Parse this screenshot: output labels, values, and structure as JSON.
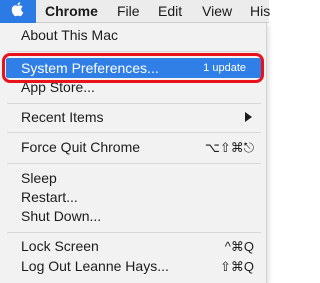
{
  "menubar": {
    "app_name": "Chrome",
    "items": [
      "File",
      "Edit",
      "View",
      "His"
    ],
    "apple_icon": "apple-logo-icon",
    "apple_tab_color": "#2c7be5"
  },
  "apple_menu": {
    "about": "About This Mac",
    "system_preferences": "System Preferences...",
    "system_preferences_badge": "1 update",
    "app_store": "App Store...",
    "recent_items": "Recent Items",
    "force_quit": "Force Quit Chrome",
    "force_quit_shortcut": "⌥⇧⌘⎋",
    "sleep": "Sleep",
    "restart": "Restart...",
    "shut_down": "Shut Down...",
    "lock_screen": "Lock Screen",
    "lock_screen_shortcut": "^⌘Q",
    "log_out": "Log Out Leanne Hays...",
    "log_out_shortcut": "⇧⌘Q",
    "highlight_color": "#2f7fe6",
    "annotation_color": "#e8121b"
  }
}
